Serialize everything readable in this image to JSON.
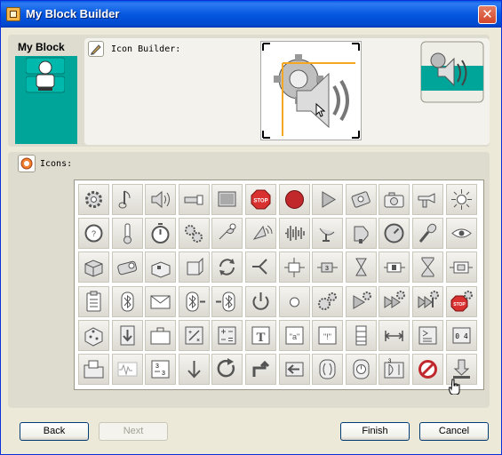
{
  "window": {
    "title": "My Block Builder",
    "close_symbol": "✕"
  },
  "myblock": {
    "label": "My Block"
  },
  "icon_builder": {
    "label": "Icon Builder:"
  },
  "icons_section": {
    "label": "Icons:"
  },
  "icons": [
    [
      "gear-icon",
      "note-icon",
      "speaker-icon",
      "lamp-icon",
      "display-icon",
      "stop-sign-icon",
      "record-icon",
      "play-icon",
      "motor-icon",
      "camera-icon",
      "flashlight-icon",
      "sun-icon"
    ],
    [
      "rotation-icon",
      "thermometer-icon",
      "stopwatch-icon",
      "gears-icon",
      "touch-icon",
      "satellite-icon",
      "sound-wave-icon",
      "dish-icon",
      "loudspeaker-icon",
      "meter-icon",
      "microphone-icon",
      "eye-icon"
    ],
    [
      "box-icon",
      "motor-cube-icon",
      "block-icon",
      "cube-icon",
      "refresh-icon",
      "branch-icon",
      "ports-icon",
      "ports2-icon",
      "hourglass-icon",
      "switch-icon",
      "hourglass2-icon",
      "route-icon"
    ],
    [
      "clipboard-icon",
      "bluetooth-icon",
      "mail-icon",
      "bluetooth-send-icon",
      "bluetooth-receive-icon",
      "power-icon",
      "dot-icon",
      "gear-dots-icon",
      "play-gear-icon",
      "fast-forward-gear-icon",
      "skip-gear-icon",
      "stop-gear-icon"
    ],
    [
      "dice-icon",
      "down-arrow-icon",
      "briefcase-icon",
      "divide-icon",
      "math-icon",
      "text-icon",
      "quote-a-icon",
      "quote-icon",
      "stack-icon",
      "range-icon",
      "compare-icon",
      "counter-icon"
    ],
    [
      "folder-icon",
      "wave-icon",
      "numbers-icon",
      "arrow-down-icon",
      "reload-icon",
      "turn-icon",
      "back-arrow-icon",
      "orb-icon",
      "clock-orb-icon",
      "swap-icon",
      "no-icon",
      "download-icon"
    ]
  ],
  "icon_labels": {
    "stop_text": "STOP",
    "quote_a": "\"a\"",
    "quote_q": "\"!\"",
    "counter": "0 4"
  },
  "buttons": {
    "back": "Back",
    "next": "Next",
    "finish": "Finish",
    "cancel": "Cancel"
  },
  "colors": {
    "accent_teal": "#00a59a",
    "titlebar": "#0558e0",
    "crosshair": "#f5a623"
  }
}
